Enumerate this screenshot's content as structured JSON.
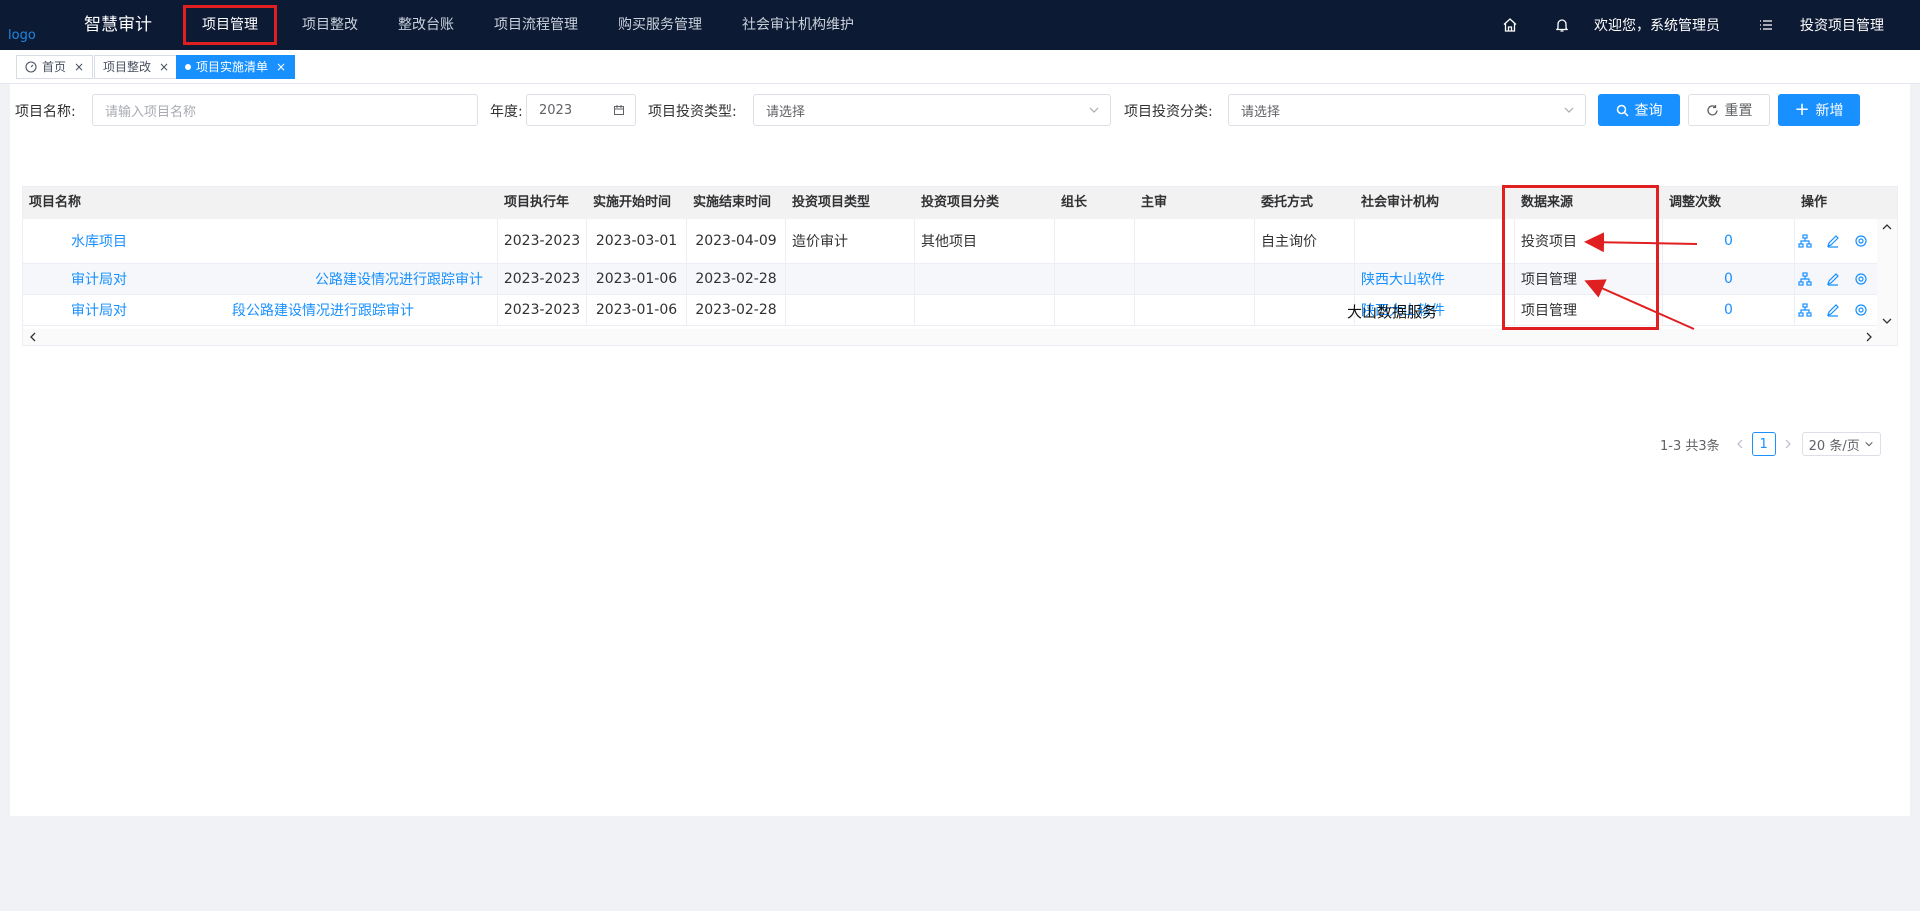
{
  "header": {
    "logo": "logo",
    "brand": "智慧审计",
    "nav": [
      "项目管理",
      "项目整改",
      "整改台账",
      "项目流程管理",
      "购买服务管理",
      "社会审计机构维护"
    ],
    "welcome": "欢迎您，系统管理员",
    "module": "投资项目管理"
  },
  "tabs": [
    {
      "label": "首页",
      "active": false
    },
    {
      "label": "项目整改",
      "active": false
    },
    {
      "label": "项目实施清单",
      "active": true
    }
  ],
  "filters": {
    "name_label": "项目名称:",
    "name_placeholder": "请输入项目名称",
    "year_label": "年度:",
    "year_value": "2023",
    "type_label": "项目投资类型:",
    "type_placeholder": "请选择",
    "category_label": "项目投资分类:",
    "category_placeholder": "请选择",
    "search_label": "查询",
    "reset_label": "重置",
    "add_label": "新增"
  },
  "table": {
    "headers": [
      "项目名称",
      "项目执行年",
      "实施开始时间",
      "实施结束时间",
      "投资项目类型",
      "投资项目分类",
      "组长",
      "主审",
      "委托方式",
      "社会审计机构",
      "数据来源",
      "调整次数",
      "操作"
    ],
    "rows": [
      {
        "name": "水库项目",
        "name2": "",
        "year": "2023-2023",
        "start": "2023-03-01",
        "end": "2023-04-09",
        "type": "造价审计",
        "category": "其他项目",
        "leader": "",
        "chief": "",
        "entrust": "自主询价",
        "agency": "",
        "source": "投资项目",
        "adjust": "0"
      },
      {
        "name": "审计局对",
        "name2": "公路建设情况进行跟踪审计",
        "year": "2023-2023",
        "start": "2023-01-06",
        "end": "2023-02-28",
        "type": "",
        "category": "",
        "leader": "",
        "chief": "",
        "entrust": "",
        "agency": "陕西大山软件",
        "source": "项目管理",
        "adjust": "0"
      },
      {
        "name": "审计局对",
        "name2": "段公路建设情况进行跟踪审计",
        "year": "2023-2023",
        "start": "2023-01-06",
        "end": "2023-02-28",
        "type": "",
        "category": "",
        "leader": "",
        "chief": "",
        "entrust": "",
        "agency": "陕西大山软件",
        "source": "项目管理",
        "adjust": "0"
      }
    ]
  },
  "overlay_text": "大山数据服务",
  "pagination": {
    "summary": "1-3 共3条",
    "current": "1",
    "page_size": "20 条/页"
  },
  "colors": {
    "accent": "#1890ff",
    "header_bg": "#0d1a33",
    "highlight": "#e02020"
  }
}
